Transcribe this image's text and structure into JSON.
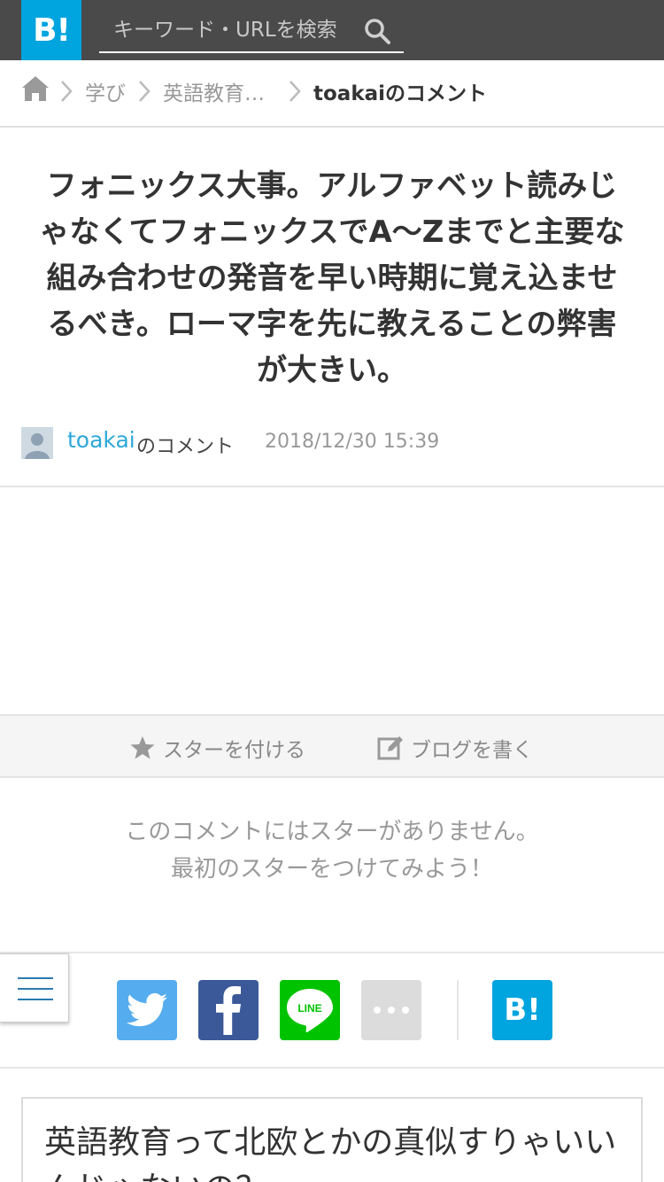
{
  "header": {
    "logo_text": "B!",
    "search_placeholder": "キーワード・URLを検索",
    "search_icon": "search-icon"
  },
  "breadcrumb": {
    "home_icon": "home-icon",
    "items": [
      "学び",
      "英語教育…"
    ],
    "current": "toakaiのコメント"
  },
  "comment": {
    "text": "フォニックス大事。アルファベット読みじゃなくてフォニックスでA〜Zまでと主要な組み合わせの発音を早い時期に覚え込ませるべき。ローマ字を先に教えることの弊害が大きい。",
    "author": "toakai",
    "author_suffix": "のコメント",
    "timestamp": "2018/12/30 15:39"
  },
  "actions": {
    "star_label": "スターを付ける",
    "blog_label": "ブログを書く"
  },
  "stars": {
    "line1": "このコメントにはスターがありません。",
    "line2": "最初のスターをつけてみよう！"
  },
  "share": {
    "line_label": "LINE",
    "hatena_label": "B!",
    "icons": [
      "twitter-icon",
      "facebook-icon",
      "line-icon",
      "more-icon",
      "hatena-icon"
    ]
  },
  "next_comment": {
    "text": "英語教育って北欧とかの真似すりゃいいんじゃないの？"
  },
  "colors": {
    "header_bg": "#4a4a4a",
    "brand": "#00a4de",
    "link": "#2ea8d8",
    "twitter": "#55acee",
    "facebook": "#3b5998",
    "line": "#00c300"
  }
}
